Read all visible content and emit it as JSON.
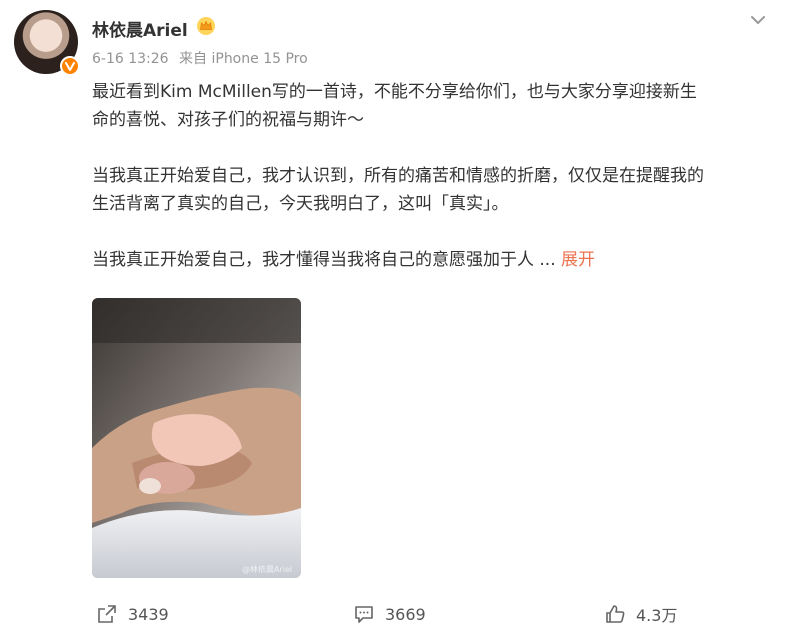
{
  "post": {
    "username": "林依晨Ariel",
    "date": "6-16 13:26",
    "source": "来自 iPhone 15 Pro",
    "paragraphs": [
      {
        "lines": [
          "最近看到Kim McMillen写的一首诗，不能不分享给你们，也与大家分享迎接新生",
          "命的喜悦、对孩子们的祝福与期许～"
        ]
      },
      {
        "lines": [
          "当我真正开始爱自己，我才认识到，所有的痛苦和情感的折磨，仅仅是在提醒我的",
          "生活背离了真实的自己，今天我明白了，这叫「真实」。"
        ]
      },
      {
        "lines": [
          "当我真正开始爱自己，我才懂得当我将自己的意愿强加于人"
        ]
      }
    ],
    "ellipsis": " ...",
    "expand_label": "展开",
    "watermark": "@林依晨Ariel"
  },
  "actions": {
    "share_count": "3439",
    "comment_count": "3669",
    "like_count": "4.3万"
  },
  "colors": {
    "expand": "#eb7350",
    "verified_badge": "#ff8200",
    "meta_text": "#939393"
  },
  "icons": [
    "avatar",
    "verified-icon",
    "crown-icon",
    "more-icon",
    "share-icon",
    "comment-icon",
    "like-icon"
  ]
}
